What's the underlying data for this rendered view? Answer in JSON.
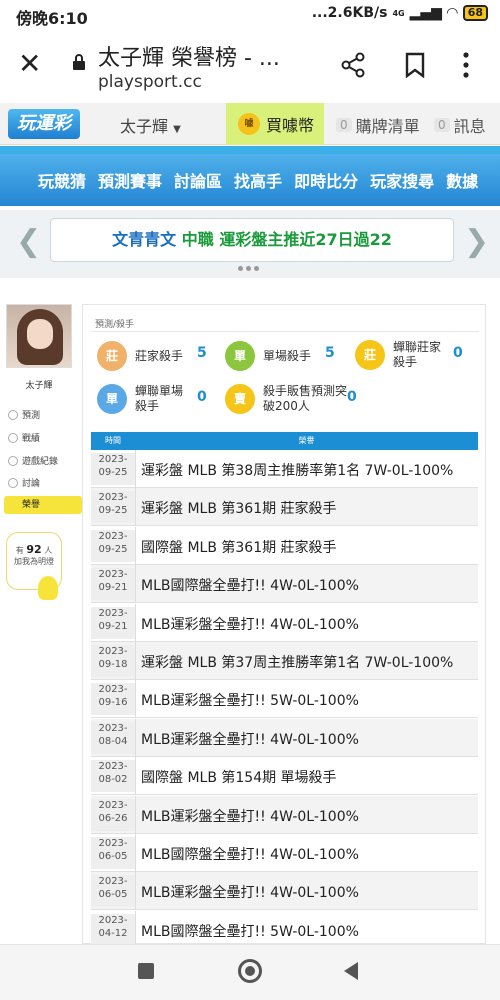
{
  "status_bar": {
    "time": "傍晚6:10",
    "speed": "...2.6KB/s",
    "network": "4G",
    "battery": "68"
  },
  "browser": {
    "title": "太子輝 榮譽榜 - ...",
    "url": "playsport.cc"
  },
  "site_header": {
    "logo": "玩運彩",
    "user": "太子輝",
    "buy_coin": "買噱幣",
    "coin_icon": "噱",
    "cart": {
      "count": "0",
      "label": "購牌清單"
    },
    "message": {
      "count": "0",
      "label": "訊息"
    }
  },
  "nav": {
    "items": [
      "玩競猜",
      "預測賽事",
      "討論區",
      "找高手",
      "即時比分",
      "玩家搜尋",
      "數據"
    ]
  },
  "banner": {
    "name": "文青青文",
    "league": "中職",
    "text": "運彩盤主推近27日過22"
  },
  "sidebar": {
    "username": "太子輝",
    "items": [
      "預測",
      "戰績",
      "遊戲紀錄",
      "討論",
      "榮譽"
    ],
    "fans_prefix": "有",
    "fans_count": "92",
    "fans_unit": "人",
    "fans_suffix": "加我為明燈"
  },
  "main": {
    "breadcrumb": "預測/殺手",
    "badges": [
      {
        "icon": "莊",
        "label": "莊家殺手",
        "count": "5",
        "color": "#e67e22"
      },
      {
        "icon": "單",
        "label": "單場殺手",
        "count": "5",
        "color": "#5aa02c"
      },
      {
        "icon": "莊",
        "label": "蟬聯莊家殺手",
        "count": "0",
        "color": "#e6a817"
      },
      {
        "icon": "單",
        "label": "蟬聯單場殺手",
        "count": "0",
        "color": "#3a8fd0"
      },
      {
        "icon": "賣",
        "label": "殺手販售預測突破200人",
        "count": "0",
        "color": "#e6b800"
      }
    ],
    "table": {
      "headers": [
        "時間",
        "榮譽"
      ],
      "rows": [
        {
          "date": "2023-09-25",
          "honor": "運彩盤 MLB 第38周主推勝率第1名 7W-0L-100%"
        },
        {
          "date": "2023-09-25",
          "honor": "運彩盤 MLB 第361期 莊家殺手"
        },
        {
          "date": "2023-09-25",
          "honor": "國際盤 MLB 第361期 莊家殺手"
        },
        {
          "date": "2023-09-21",
          "honor": "MLB國際盤全壘打!! 4W-0L-100%"
        },
        {
          "date": "2023-09-21",
          "honor": "MLB運彩盤全壘打!! 4W-0L-100%"
        },
        {
          "date": "2023-09-18",
          "honor": "運彩盤 MLB 第37周主推勝率第1名 7W-0L-100%"
        },
        {
          "date": "2023-09-16",
          "honor": "MLB運彩盤全壘打!! 5W-0L-100%"
        },
        {
          "date": "2023-08-04",
          "honor": "MLB運彩盤全壘打!! 4W-0L-100%"
        },
        {
          "date": "2023-08-02",
          "honor": "國際盤 MLB 第154期 單場殺手"
        },
        {
          "date": "2023-06-26",
          "honor": "MLB運彩盤全壘打!! 4W-0L-100%"
        },
        {
          "date": "2023-06-05",
          "honor": "MLB國際盤全壘打!! 4W-0L-100%"
        },
        {
          "date": "2023-06-05",
          "honor": "MLB運彩盤全壘打!! 4W-0L-100%"
        },
        {
          "date": "2023-04-12",
          "honor": "MLB國際盤全壘打!! 5W-0L-100%"
        }
      ]
    }
  }
}
